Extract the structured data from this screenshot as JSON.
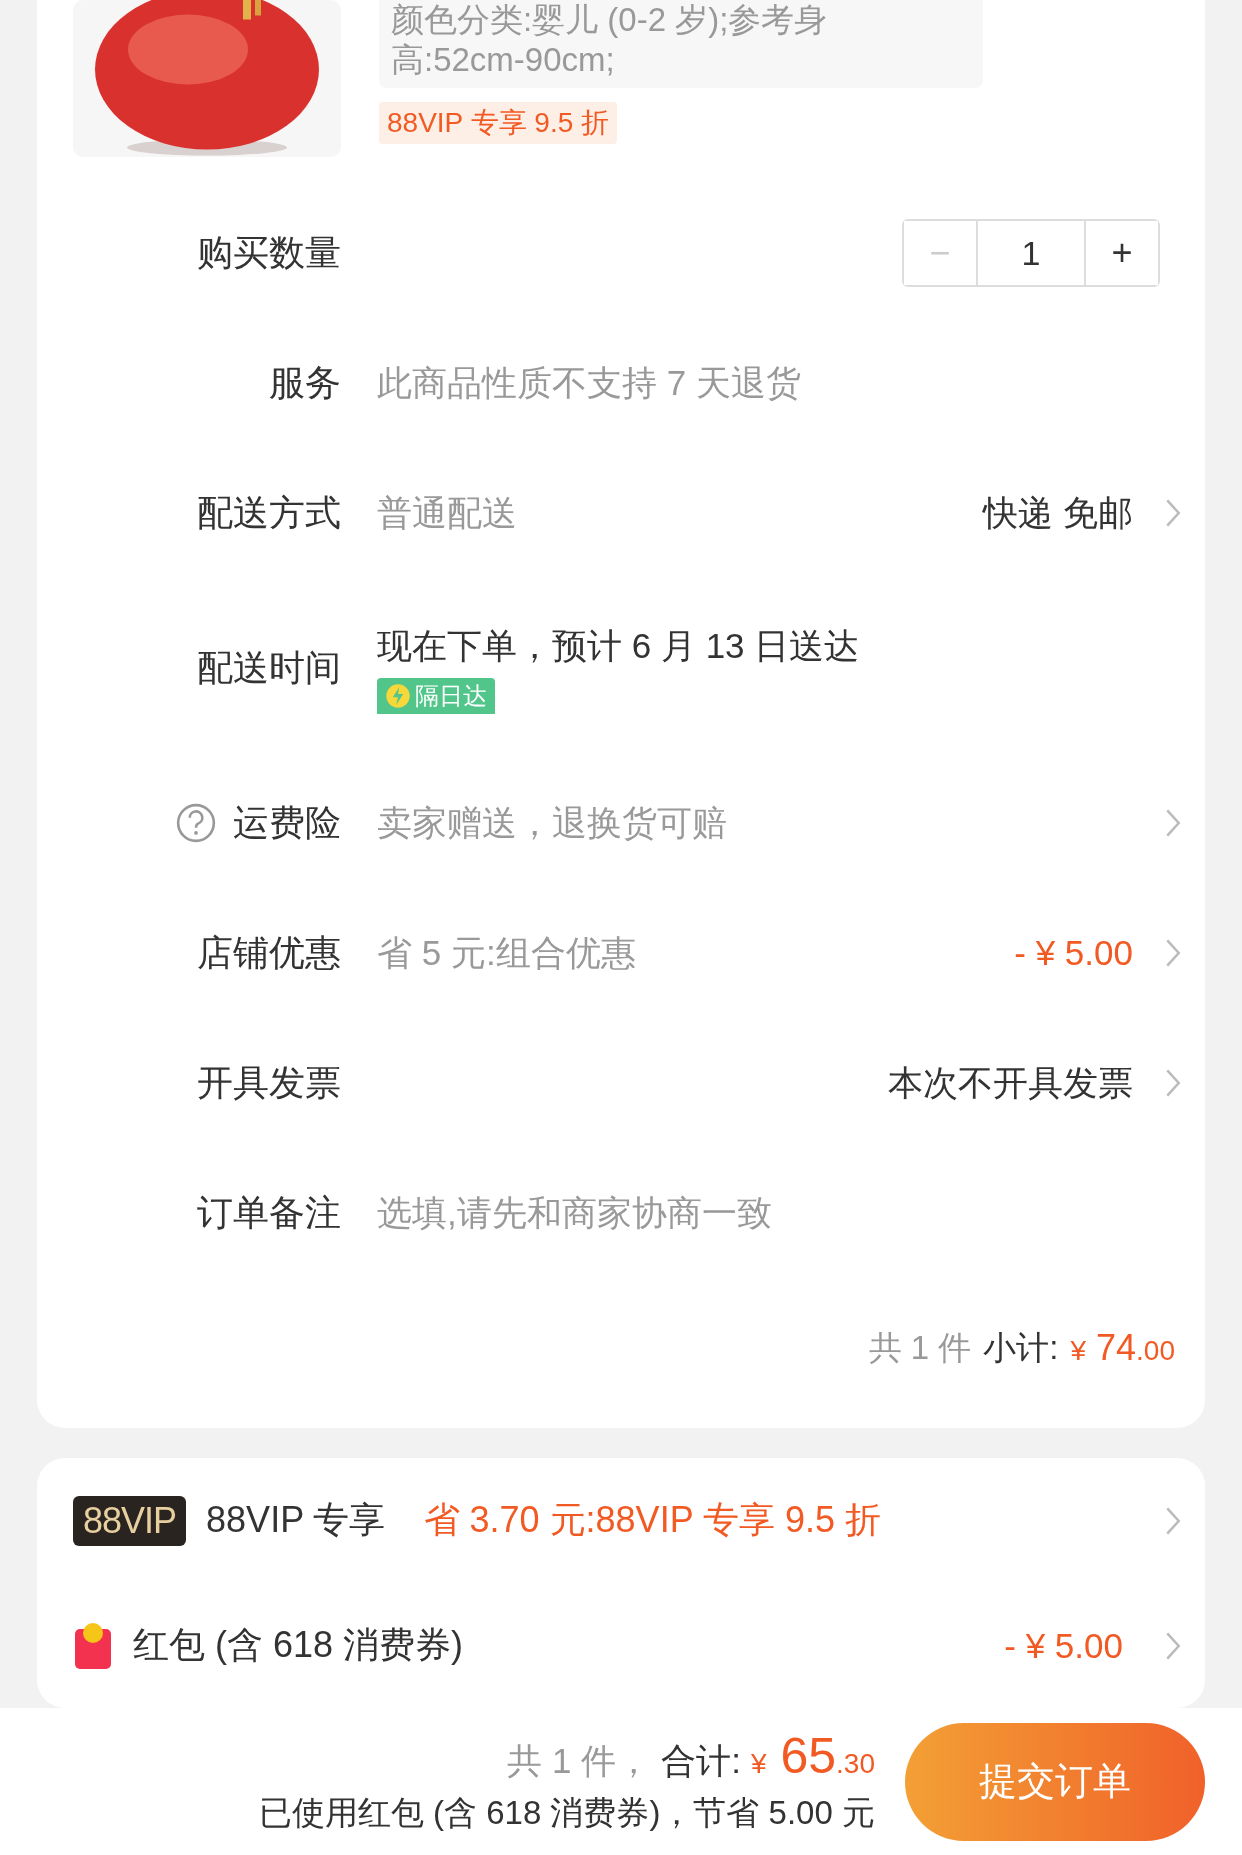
{
  "product": {
    "spec_lines": [
      "颜色分类:婴儿 (0-2 岁);参考身",
      "高:52cm-90cm;"
    ],
    "vip_tag": "88VIP 专享 9.5 折"
  },
  "quantity": {
    "label": "购买数量",
    "minus": "−",
    "value": "1",
    "plus": "+",
    "minus_disabled": true
  },
  "rows": [
    {
      "kind": "service",
      "label": "服务",
      "value": "此商品性质不支持 7 天退货",
      "value_muted": true,
      "help": false,
      "chevron": false
    },
    {
      "kind": "shipping",
      "label": "配送方式",
      "value": "普通配送",
      "value_muted": true,
      "right": "快递 免邮",
      "right_price": false,
      "help": false,
      "chevron": true
    },
    {
      "kind": "delivery_time",
      "label": "配送时间",
      "value": "现在下单，预计 6 月 13 日送达",
      "badge": "隔日达",
      "help": false,
      "chevron": false
    },
    {
      "kind": "insurance",
      "label": "运费险",
      "value": "卖家赠送，退换货可赔",
      "value_muted": true,
      "help": true,
      "chevron": true
    },
    {
      "kind": "shop_discount",
      "label": "店铺优惠",
      "value": "省 5 元:组合优惠",
      "value_muted": true,
      "right": "- ¥ 5.00",
      "right_price": true,
      "help": false,
      "chevron": true
    },
    {
      "kind": "invoice",
      "label": "开具发票",
      "right": "本次不开具发票",
      "right_price": false,
      "help": false,
      "chevron": true
    },
    {
      "kind": "note",
      "label": "订单备注",
      "placeholder": "选填,请先和商家协商一致",
      "help": false,
      "chevron": false
    }
  ],
  "subtotal": {
    "count": "共 1 件",
    "label": "小计:",
    "currency": "¥",
    "integer": "74",
    "decimal": ".00"
  },
  "benefits": [
    {
      "kind": "vip",
      "badge": "88VIP",
      "label": "88VIP 专享",
      "value": "省 3.70 元:88VIP 专享 9.5 折",
      "chevron": true
    },
    {
      "kind": "red_packet",
      "label": "红包 (含 618 消费券)",
      "right": "- ¥ 5.00",
      "chevron": true
    }
  ],
  "footer": {
    "count": "共 1 件，",
    "label": "合计:",
    "currency": "¥",
    "integer": "65",
    "decimal": ".30",
    "note": "已使用红包 (含 618 消费券)，节省 5.00 元",
    "submit": "提交订单"
  }
}
